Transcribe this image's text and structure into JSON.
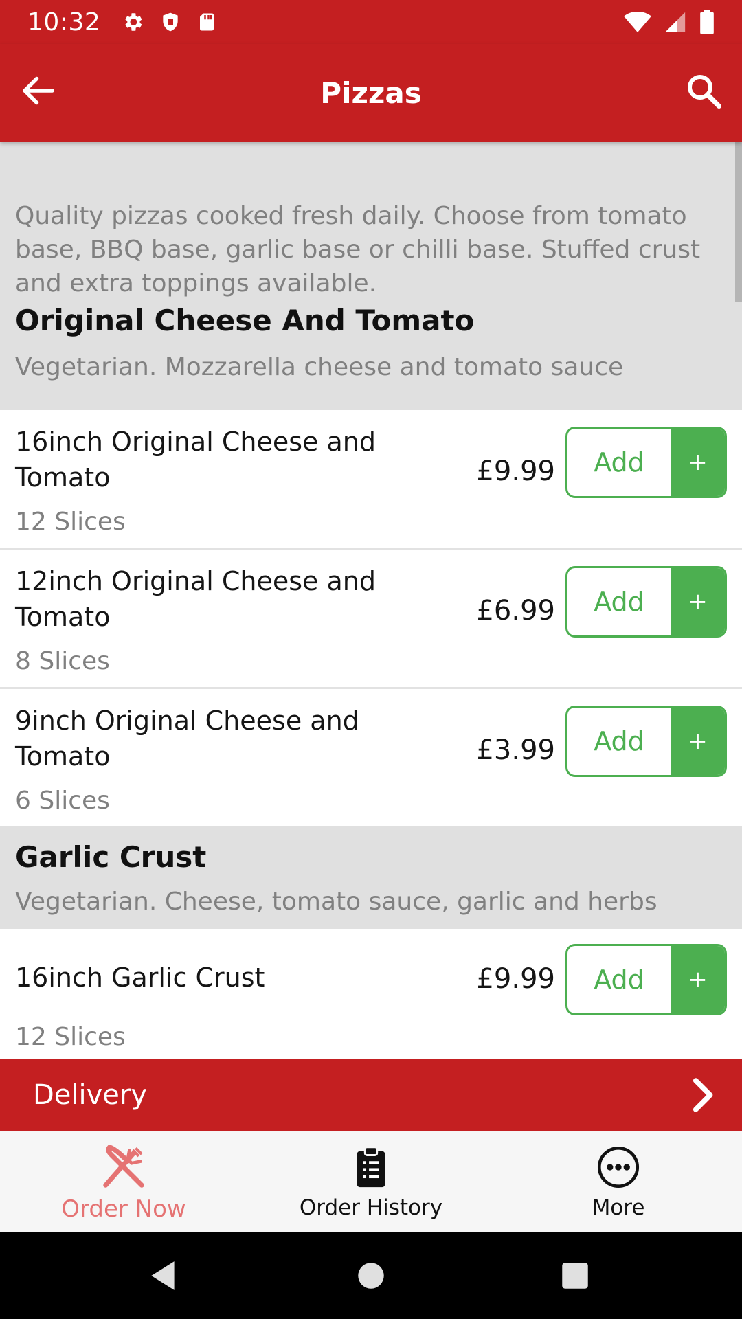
{
  "status_bar": {
    "time": "10:32",
    "icons_left": [
      "gear-icon",
      "shield-icon",
      "sd-card-icon"
    ],
    "icons_right": [
      "wifi-icon",
      "signal-icon",
      "battery-icon"
    ]
  },
  "app_bar": {
    "title": "Pizzas",
    "back_icon": "arrow-left-icon",
    "search_icon": "search-icon"
  },
  "intro_text": "Quality pizzas cooked fresh daily. Choose from tomato base, BBQ base, garlic base or chilli base. Stuffed crust and extra toppings available.",
  "sections": [
    {
      "title": "Original Cheese And Tomato",
      "description": "Vegetarian. Mozzarella cheese and tomato sauce",
      "items": [
        {
          "name": "16inch Original Cheese and Tomato",
          "sub": "12 Slices",
          "price": "£9.99",
          "add_label": "Add",
          "plus": "+"
        },
        {
          "name": "12inch Original Cheese and Tomato",
          "sub": "8 Slices",
          "price": "£6.99",
          "add_label": "Add",
          "plus": "+"
        },
        {
          "name": "9inch Original Cheese and Tomato",
          "sub": "6 Slices",
          "price": "£3.99",
          "add_label": "Add",
          "plus": "+"
        }
      ]
    },
    {
      "title": "Garlic Crust",
      "description": "Vegetarian. Cheese, tomato sauce, garlic and herbs",
      "items": [
        {
          "name": "16inch Garlic Crust",
          "sub": "12 Slices",
          "price": "£9.99",
          "add_label": "Add",
          "plus": "+"
        }
      ]
    }
  ],
  "delivery_bar": {
    "label": "Delivery",
    "icon": "chevron-right-icon"
  },
  "bottom_nav": [
    {
      "label": "Order Now",
      "icon": "fork-knife-icon",
      "active": true
    },
    {
      "label": "Order History",
      "icon": "clipboard-icon",
      "active": false
    },
    {
      "label": "More",
      "icon": "more-dots-icon",
      "active": false
    }
  ],
  "colors": {
    "brand_red": "#c41f21",
    "add_green": "#4caf50",
    "active_nav": "#e57373",
    "section_grey": "#e0e0e0"
  }
}
